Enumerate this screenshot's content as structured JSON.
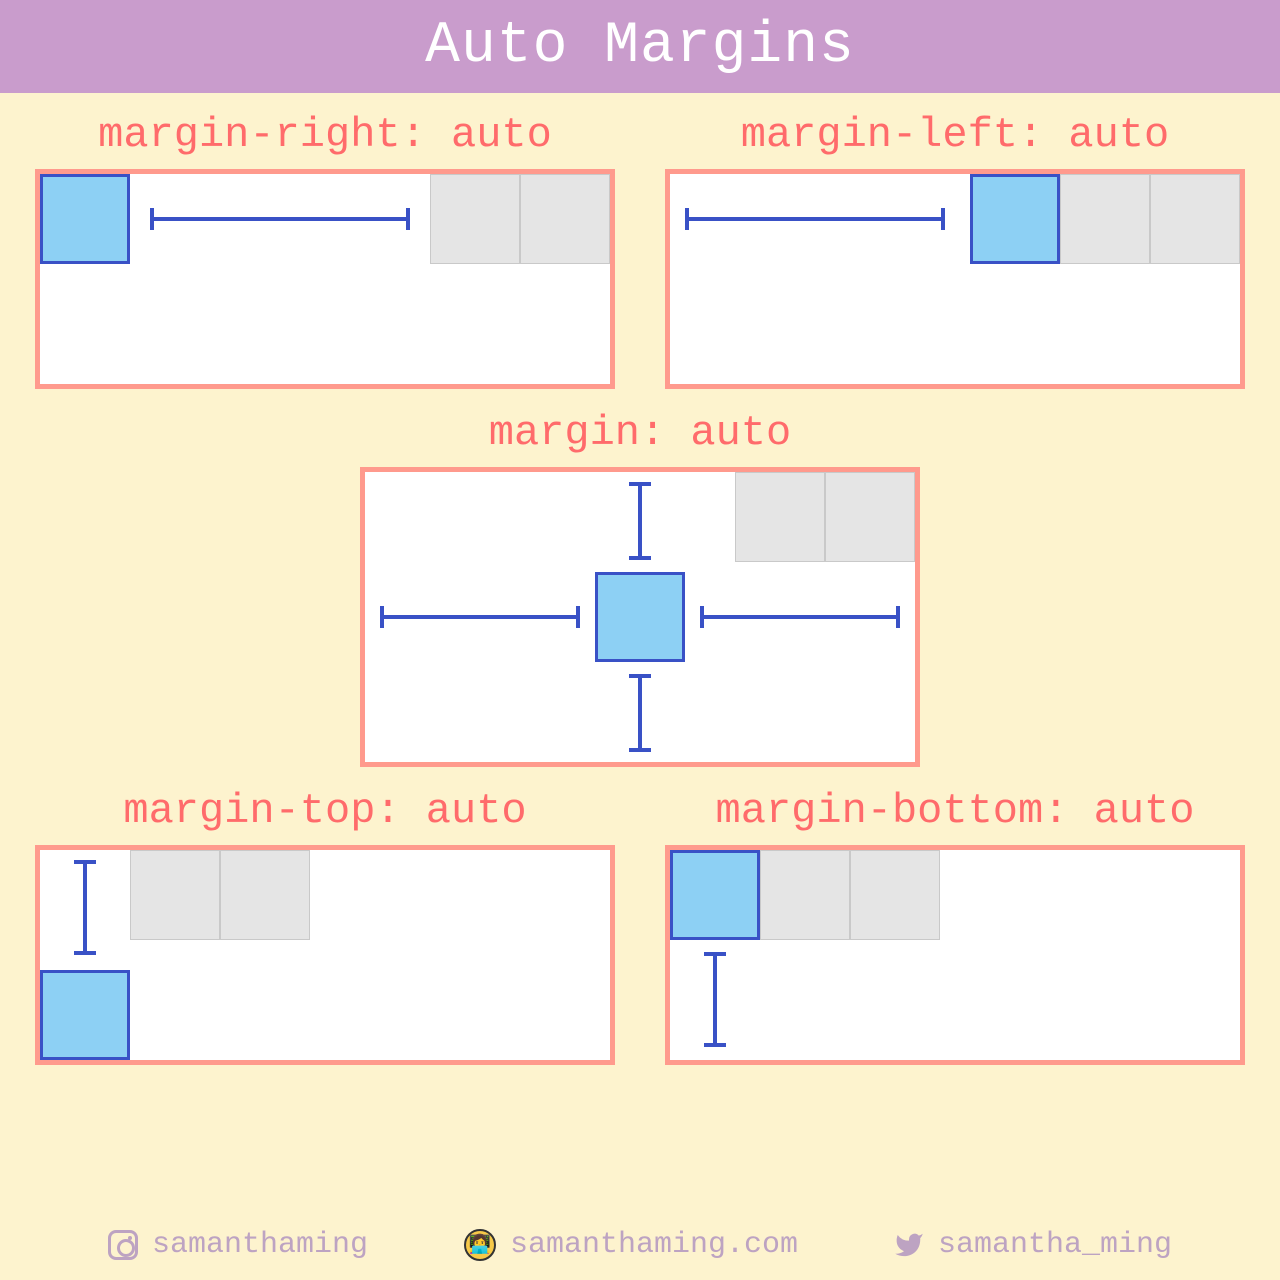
{
  "title": "Auto Margins",
  "examples": {
    "margin_right": {
      "label": "margin-right: auto"
    },
    "margin_left": {
      "label": "margin-left: auto"
    },
    "margin_all": {
      "label": "margin: auto"
    },
    "margin_top": {
      "label": "margin-top: auto"
    },
    "margin_bottom": {
      "label": "margin-bottom: auto"
    }
  },
  "footer": {
    "instagram": "samanthaming",
    "website": "samanthaming.com",
    "twitter": "samantha_ming"
  }
}
